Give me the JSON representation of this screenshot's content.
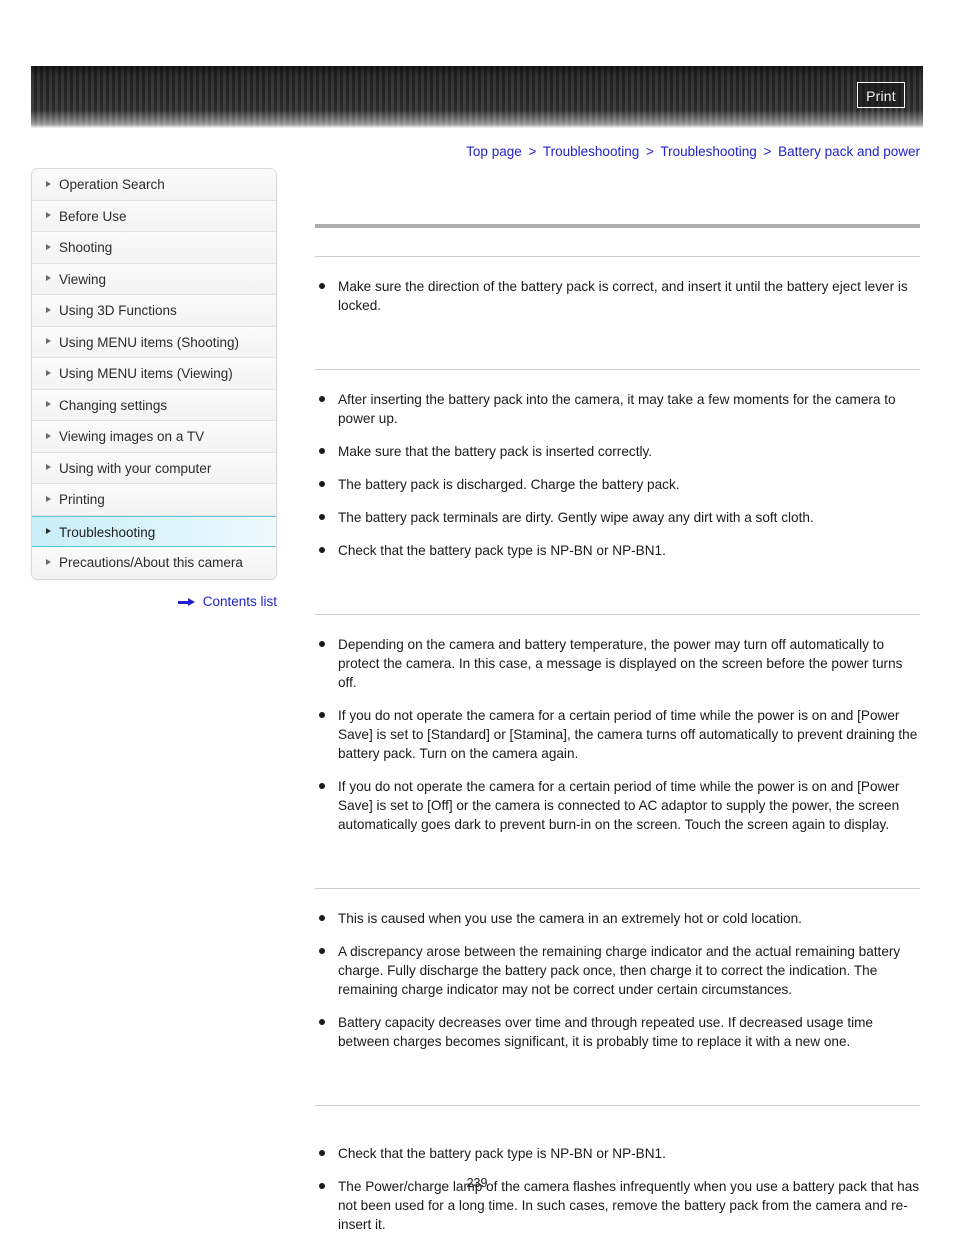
{
  "header": {
    "print_label": "Print",
    "stripe_color_dark": "#242424",
    "stripe_color_light": "#3a3a3a"
  },
  "breadcrumb": {
    "items": [
      "Top page",
      "Troubleshooting",
      "Troubleshooting",
      "Battery pack and power"
    ],
    "separator": ">",
    "link_color": "#2222cc"
  },
  "sidebar": {
    "accent_color": "#5ec7e0",
    "items": [
      {
        "label": "Operation Search",
        "selected": false
      },
      {
        "label": "Before Use",
        "selected": false
      },
      {
        "label": "Shooting",
        "selected": false
      },
      {
        "label": "Viewing",
        "selected": false
      },
      {
        "label": "Using 3D Functions",
        "selected": false
      },
      {
        "label": "Using MENU items (Shooting)",
        "selected": false
      },
      {
        "label": "Using MENU items (Viewing)",
        "selected": false
      },
      {
        "label": "Changing settings",
        "selected": false
      },
      {
        "label": "Viewing images on a TV",
        "selected": false
      },
      {
        "label": "Using with your computer",
        "selected": false
      },
      {
        "label": "Printing",
        "selected": false
      },
      {
        "label": "Troubleshooting",
        "selected": true
      },
      {
        "label": "Precautions/About this camera",
        "selected": false
      }
    ],
    "contents_list_label": "Contents list",
    "contents_list_icon": "right-arrow-icon"
  },
  "main": {
    "page_title": "",
    "sections": [
      {
        "heading": "",
        "bullets": [
          "Make sure the direction of the battery pack is correct, and insert it until the battery eject lever is locked."
        ]
      },
      {
        "heading": "",
        "bullets": [
          "After inserting the battery pack into the camera, it may take a few moments for the camera to power up.",
          "Make sure that the battery pack is inserted correctly.",
          "The battery pack is discharged. Charge the battery pack.",
          "The battery pack terminals are dirty. Gently wipe away any dirt with a soft cloth.",
          "Check that the battery pack type is NP-BN or NP-BN1."
        ]
      },
      {
        "heading": "",
        "bullets": [
          "Depending on the camera and battery temperature, the power may turn off automatically to protect the camera. In this case, a message is displayed on the screen before the power turns off.",
          "If you do not operate the camera for a certain period of time while the power is on and [Power Save] is set to [Standard] or [Stamina], the camera turns off automatically to prevent draining the battery pack. Turn on the camera again.",
          "If you do not operate the camera for a certain period of time while the power is on and [Power Save] is set to [Off] or the camera is connected to AC adaptor to supply the power, the screen automatically goes dark to prevent burn-in on the screen. Touch the screen again to display."
        ]
      },
      {
        "heading": "",
        "bullets": [
          "This is caused when you use the camera in an extremely hot or cold location.",
          "A discrepancy arose between the remaining charge indicator and the actual remaining battery charge. Fully discharge the battery pack once, then charge it to correct the indication. The remaining charge indicator may not be correct under certain circumstances.",
          "Battery capacity decreases over time and through repeated use. If decreased usage time between charges becomes significant, it is probably time to replace it with a new one."
        ]
      },
      {
        "heading": "",
        "bullets": [
          "Check that the battery pack type is NP-BN or NP-BN1.",
          "The Power/charge lamp of the camera flashes infrequently when you use a battery pack that has not been used for a long time. In such cases, remove the battery pack from the camera and re-insert it."
        ]
      }
    ]
  },
  "footer": {
    "page_number": "239"
  }
}
